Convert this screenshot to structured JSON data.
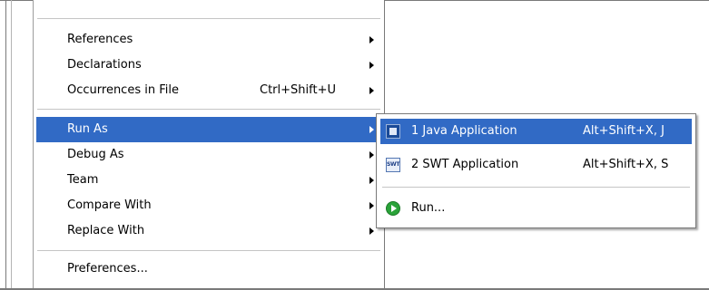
{
  "menu": {
    "items": [
      {
        "label": "References",
        "shortcut": "",
        "submenu": true
      },
      {
        "label": "Declarations",
        "shortcut": "",
        "submenu": true
      },
      {
        "label": "Occurrences in File",
        "shortcut": "Ctrl+Shift+U",
        "submenu": true
      },
      {
        "label": "Run As",
        "shortcut": "",
        "submenu": true,
        "selected": true
      },
      {
        "label": "Debug As",
        "shortcut": "",
        "submenu": true
      },
      {
        "label": "Team",
        "shortcut": "",
        "submenu": true
      },
      {
        "label": "Compare With",
        "shortcut": "",
        "submenu": true
      },
      {
        "label": "Replace With",
        "shortcut": "",
        "submenu": true
      },
      {
        "label": "Preferences...",
        "shortcut": "",
        "submenu": false
      }
    ]
  },
  "submenu": {
    "items": [
      {
        "label": "1 Java Application",
        "shortcut": "Alt+Shift+X, J",
        "icon": "java-application-icon",
        "selected": true
      },
      {
        "label": "2 SWT Application",
        "shortcut": "Alt+Shift+X, S",
        "icon": "swt-application-icon",
        "icon_text": "SWT"
      },
      {
        "label": "Run...",
        "shortcut": "",
        "icon": "run-icon"
      }
    ]
  },
  "colors": {
    "selection": "#316ac5",
    "selection_text": "#ffffff",
    "separator": "#c5c5c5"
  }
}
